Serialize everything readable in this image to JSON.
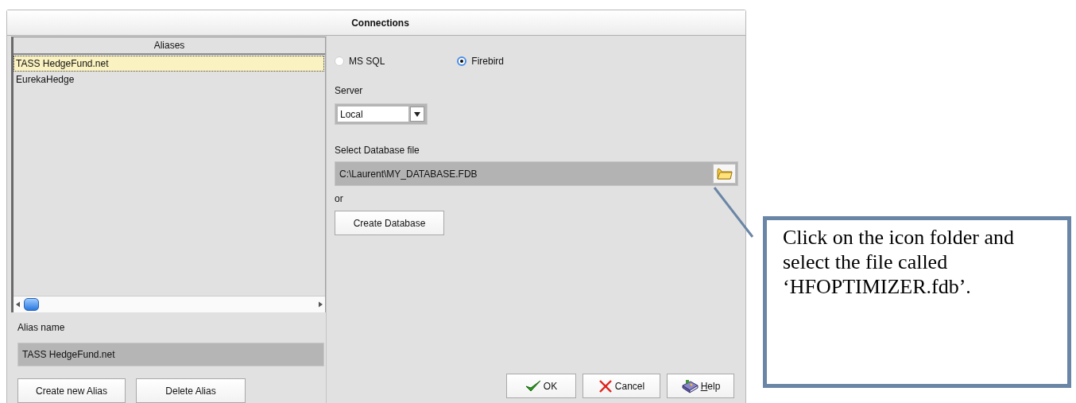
{
  "window": {
    "title": "Connections"
  },
  "aliases": {
    "header": "Aliases",
    "items": [
      {
        "label": "TASS HedgeFund.net",
        "selected": true
      },
      {
        "label": "EurekaHedge",
        "selected": false
      }
    ]
  },
  "alias_name": {
    "label": "Alias name",
    "value": "TASS HedgeFund.net"
  },
  "alias_buttons": [
    "Create new Alias",
    "Delete Alias"
  ],
  "database_types": [
    {
      "label": "MS SQL",
      "selected": false
    },
    {
      "label": "Firebird",
      "selected": true
    }
  ],
  "server": {
    "label": "Server",
    "value": "Local"
  },
  "database_file": {
    "label": "Select Database file",
    "value": "C:\\Laurent\\MY_DATABASE.FDB"
  },
  "or_label": "or",
  "create_database_button": "Create Database",
  "dialog_buttons": [
    {
      "kind": "ok",
      "label": "OK"
    },
    {
      "kind": "cancel",
      "label": "Cancel"
    },
    {
      "kind": "help",
      "label": "Help"
    }
  ],
  "callout": {
    "text": "Click on the icon folder and select the file called ‘HFOPTIMIZER.fdb’."
  }
}
